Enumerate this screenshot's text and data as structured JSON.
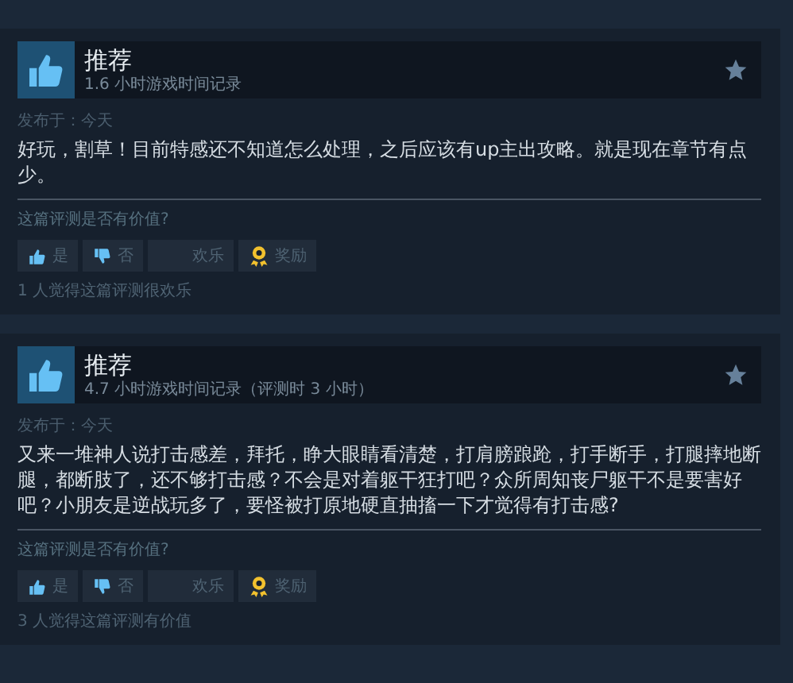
{
  "reviews": [
    {
      "recommended": true,
      "verdict": "推荐",
      "hours": "1.6 小时游戏时间记录",
      "posted": "发布于：今天",
      "body": "好玩，割草！目前特感还不知道怎么处理，之后应该有up主出攻略。就是现在章节有点少。",
      "helpful_prompt": "这篇评测是否有价值?",
      "buttons": [
        {
          "kind": "yes",
          "label": "是"
        },
        {
          "kind": "no",
          "label": "否"
        },
        {
          "kind": "funny",
          "label": "欢乐"
        },
        {
          "kind": "award",
          "label": "奖励"
        }
      ],
      "footer": "1 人觉得这篇评测很欢乐"
    },
    {
      "recommended": true,
      "verdict": "推荐",
      "hours": "4.7 小时游戏时间记录（评测时 3 小时）",
      "posted": "发布于：今天",
      "body": "又来一堆神人说打击感差，拜托，睁大眼睛看清楚，打肩膀踉跄，打手断手，打腿摔地断腿，都断肢了，还不够打击感？不会是对着躯干狂打吧？众所周知丧尸躯干不是要害好吧？小朋友是逆战玩多了，要怪被打原地硬直抽搐一下才觉得有打击感?",
      "helpful_prompt": "这篇评测是否有价值?",
      "buttons": [
        {
          "kind": "yes",
          "label": "是"
        },
        {
          "kind": "no",
          "label": "否"
        },
        {
          "kind": "funny",
          "label": "欢乐"
        },
        {
          "kind": "award",
          "label": "奖励"
        }
      ],
      "footer": "3 人觉得这篇评测有价值"
    }
  ]
}
